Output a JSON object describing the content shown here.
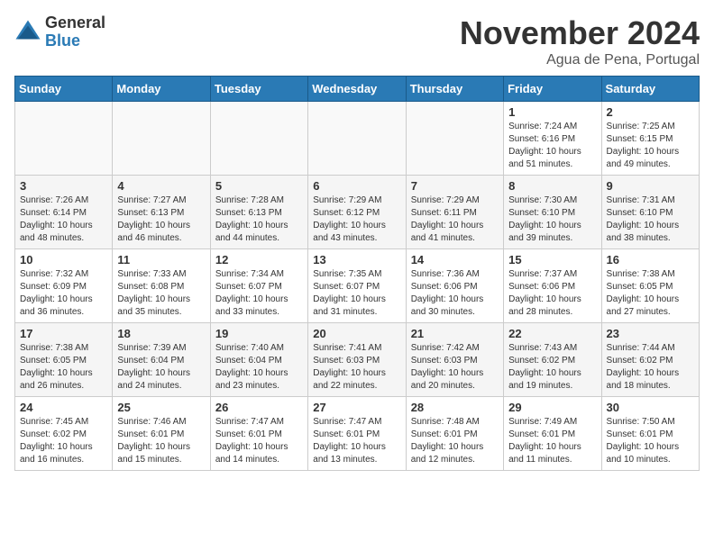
{
  "logo": {
    "general": "General",
    "blue": "Blue"
  },
  "title": "November 2024",
  "location": "Agua de Pena, Portugal",
  "headers": [
    "Sunday",
    "Monday",
    "Tuesday",
    "Wednesday",
    "Thursday",
    "Friday",
    "Saturday"
  ],
  "weeks": [
    [
      {
        "day": "",
        "info": ""
      },
      {
        "day": "",
        "info": ""
      },
      {
        "day": "",
        "info": ""
      },
      {
        "day": "",
        "info": ""
      },
      {
        "day": "",
        "info": ""
      },
      {
        "day": "1",
        "info": "Sunrise: 7:24 AM\nSunset: 6:16 PM\nDaylight: 10 hours and 51 minutes."
      },
      {
        "day": "2",
        "info": "Sunrise: 7:25 AM\nSunset: 6:15 PM\nDaylight: 10 hours and 49 minutes."
      }
    ],
    [
      {
        "day": "3",
        "info": "Sunrise: 7:26 AM\nSunset: 6:14 PM\nDaylight: 10 hours and 48 minutes."
      },
      {
        "day": "4",
        "info": "Sunrise: 7:27 AM\nSunset: 6:13 PM\nDaylight: 10 hours and 46 minutes."
      },
      {
        "day": "5",
        "info": "Sunrise: 7:28 AM\nSunset: 6:13 PM\nDaylight: 10 hours and 44 minutes."
      },
      {
        "day": "6",
        "info": "Sunrise: 7:29 AM\nSunset: 6:12 PM\nDaylight: 10 hours and 43 minutes."
      },
      {
        "day": "7",
        "info": "Sunrise: 7:29 AM\nSunset: 6:11 PM\nDaylight: 10 hours and 41 minutes."
      },
      {
        "day": "8",
        "info": "Sunrise: 7:30 AM\nSunset: 6:10 PM\nDaylight: 10 hours and 39 minutes."
      },
      {
        "day": "9",
        "info": "Sunrise: 7:31 AM\nSunset: 6:10 PM\nDaylight: 10 hours and 38 minutes."
      }
    ],
    [
      {
        "day": "10",
        "info": "Sunrise: 7:32 AM\nSunset: 6:09 PM\nDaylight: 10 hours and 36 minutes."
      },
      {
        "day": "11",
        "info": "Sunrise: 7:33 AM\nSunset: 6:08 PM\nDaylight: 10 hours and 35 minutes."
      },
      {
        "day": "12",
        "info": "Sunrise: 7:34 AM\nSunset: 6:07 PM\nDaylight: 10 hours and 33 minutes."
      },
      {
        "day": "13",
        "info": "Sunrise: 7:35 AM\nSunset: 6:07 PM\nDaylight: 10 hours and 31 minutes."
      },
      {
        "day": "14",
        "info": "Sunrise: 7:36 AM\nSunset: 6:06 PM\nDaylight: 10 hours and 30 minutes."
      },
      {
        "day": "15",
        "info": "Sunrise: 7:37 AM\nSunset: 6:06 PM\nDaylight: 10 hours and 28 minutes."
      },
      {
        "day": "16",
        "info": "Sunrise: 7:38 AM\nSunset: 6:05 PM\nDaylight: 10 hours and 27 minutes."
      }
    ],
    [
      {
        "day": "17",
        "info": "Sunrise: 7:38 AM\nSunset: 6:05 PM\nDaylight: 10 hours and 26 minutes."
      },
      {
        "day": "18",
        "info": "Sunrise: 7:39 AM\nSunset: 6:04 PM\nDaylight: 10 hours and 24 minutes."
      },
      {
        "day": "19",
        "info": "Sunrise: 7:40 AM\nSunset: 6:04 PM\nDaylight: 10 hours and 23 minutes."
      },
      {
        "day": "20",
        "info": "Sunrise: 7:41 AM\nSunset: 6:03 PM\nDaylight: 10 hours and 22 minutes."
      },
      {
        "day": "21",
        "info": "Sunrise: 7:42 AM\nSunset: 6:03 PM\nDaylight: 10 hours and 20 minutes."
      },
      {
        "day": "22",
        "info": "Sunrise: 7:43 AM\nSunset: 6:02 PM\nDaylight: 10 hours and 19 minutes."
      },
      {
        "day": "23",
        "info": "Sunrise: 7:44 AM\nSunset: 6:02 PM\nDaylight: 10 hours and 18 minutes."
      }
    ],
    [
      {
        "day": "24",
        "info": "Sunrise: 7:45 AM\nSunset: 6:02 PM\nDaylight: 10 hours and 16 minutes."
      },
      {
        "day": "25",
        "info": "Sunrise: 7:46 AM\nSunset: 6:01 PM\nDaylight: 10 hours and 15 minutes."
      },
      {
        "day": "26",
        "info": "Sunrise: 7:47 AM\nSunset: 6:01 PM\nDaylight: 10 hours and 14 minutes."
      },
      {
        "day": "27",
        "info": "Sunrise: 7:47 AM\nSunset: 6:01 PM\nDaylight: 10 hours and 13 minutes."
      },
      {
        "day": "28",
        "info": "Sunrise: 7:48 AM\nSunset: 6:01 PM\nDaylight: 10 hours and 12 minutes."
      },
      {
        "day": "29",
        "info": "Sunrise: 7:49 AM\nSunset: 6:01 PM\nDaylight: 10 hours and 11 minutes."
      },
      {
        "day": "30",
        "info": "Sunrise: 7:50 AM\nSunset: 6:01 PM\nDaylight: 10 hours and 10 minutes."
      }
    ]
  ]
}
